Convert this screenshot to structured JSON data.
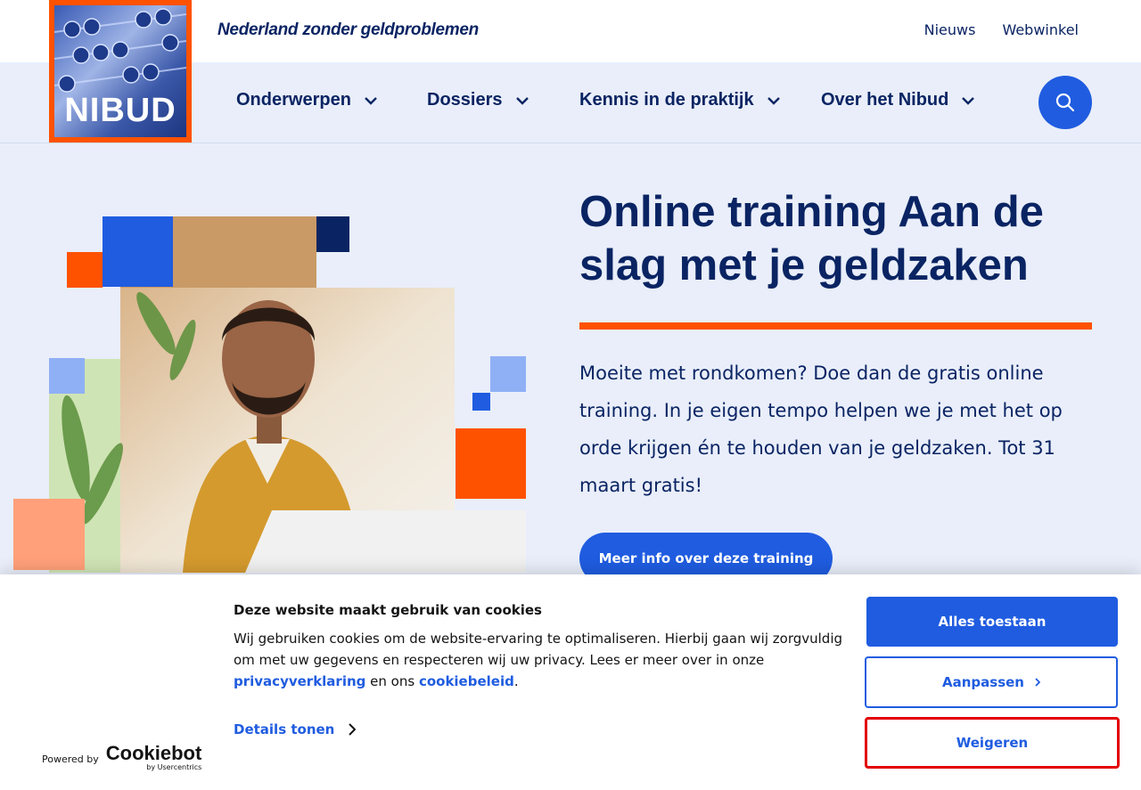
{
  "header": {
    "tagline": "Nederland zonder geldproblemen",
    "links": [
      "Nieuws",
      "Webwinkel"
    ],
    "logo_text": "NIBUD"
  },
  "nav": {
    "items": [
      "Onderwerpen",
      "Dossiers",
      "Kennis in de praktijk",
      "Over het Nibud"
    ],
    "search_icon": "search-icon"
  },
  "hero": {
    "title": "Online training Aan de slag met je geldzaken",
    "text": "Moeite met rondkomen? Doe dan de gratis online training. In je eigen tempo helpen we je met het op orde krijgen én te houden van je geldzaken. Tot 31 maart gratis!",
    "button": "Meer info over deze training"
  },
  "cookie": {
    "title": "Deze website maakt gebruik van cookies",
    "body_part1": "Wij gebruiken cookies om de website-ervaring te optimaliseren. Hierbij gaan wij zorgvuldig om met uw gegevens en respecteren wij uw privacy. Lees er meer over in onze ",
    "link1": "privacyverklaring",
    "body_part2": " en ons ",
    "link2": "cookiebeleid",
    "body_part3": ".",
    "details": "Details tonen",
    "allow": "Alles toestaan",
    "customize": "Aanpassen",
    "deny": "Weigeren",
    "powered_by": "Powered by",
    "brand": "Cookiebot",
    "brand_sub": "by Usercentrics"
  },
  "colors": {
    "navy": "#0a2463",
    "blue": "#1f5ce0",
    "orange": "#ff5200",
    "bg": "#e9eefa",
    "highlight": "#e30000"
  }
}
